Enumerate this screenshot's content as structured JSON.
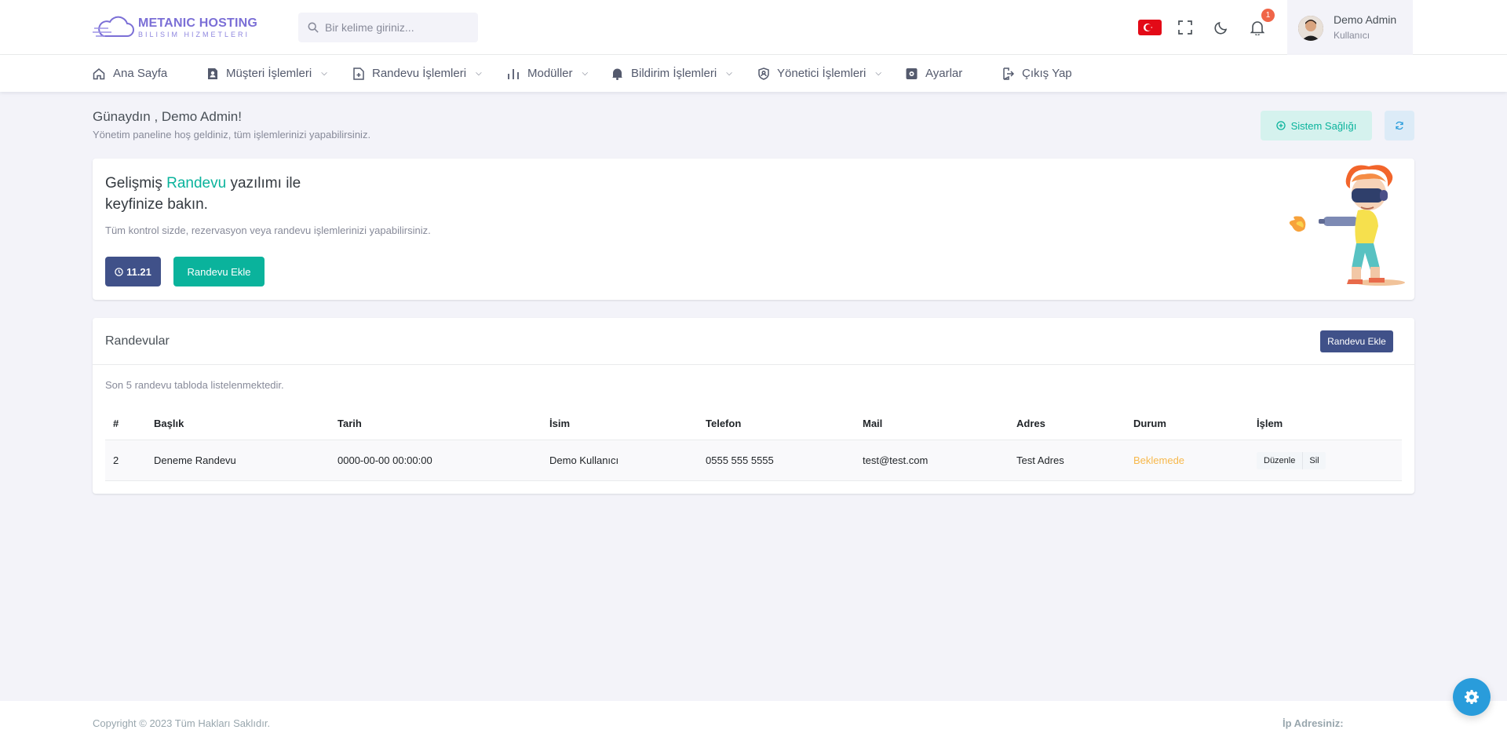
{
  "brand": {
    "title": "METANIC HOSTING",
    "subtitle": "BILISIM HIZMETLERI"
  },
  "search": {
    "placeholder": "Bir kelime giriniz..."
  },
  "header": {
    "notification_count": "1",
    "user_name": "Demo Admin",
    "user_role": "Kullanıcı",
    "flag": "tr-flag"
  },
  "nav": {
    "home": "Ana Sayfa",
    "customers": "Müşteri İşlemleri",
    "appointments": "Randevu İşlemleri",
    "modules": "Modüller",
    "notifications": "Bildirim İşlemleri",
    "admin": "Yönetici İşlemleri",
    "settings": "Ayarlar",
    "logout": "Çıkış Yap"
  },
  "page": {
    "greeting": "Günaydın , Demo Admin!",
    "greeting_sub": "Yönetim paneline hoş geldiniz, tüm işlemlerinizi yapabilirsiniz.",
    "health_button": "Sistem Sağlığı"
  },
  "hero": {
    "title_pre": "Gelişmiş ",
    "title_accent": "Randevu",
    "title_post": " yazılımı ile",
    "title_line2": "keyfinize bakın.",
    "description": "Tüm kontrol sizde, rezervasyon veya randevu işlemlerinizi yapabilirsiniz.",
    "time": "11.21",
    "add_button": "Randevu Ekle"
  },
  "appointments": {
    "title": "Randevular",
    "add_button": "Randevu Ekle",
    "description": "Son 5 randevu tabloda listelenmektedir.",
    "columns": [
      "#",
      "Başlık",
      "Tarih",
      "İsim",
      "Telefon",
      "Mail",
      "Adres",
      "Durum",
      "İşlem"
    ],
    "rows": [
      {
        "id": "2",
        "title": "Deneme Randevu",
        "date": "0000-00-00 00:00:00",
        "name": "Demo Kullanıcı",
        "phone": "0555 555 5555",
        "mail": "test@test.com",
        "address": "Test Adres",
        "status": "Beklemede",
        "edit": "Düzenle",
        "delete": "Sil"
      }
    ]
  },
  "footer": {
    "copyright": "Copyright © 2023 Tüm Hakları Saklıdır.",
    "ip_label": "İp Adresiniz:"
  },
  "colors": {
    "primary": "#405189",
    "success": "#0ab39c",
    "warning": "#f7b84b",
    "info": "#299cdb",
    "danger": "#f06548"
  }
}
